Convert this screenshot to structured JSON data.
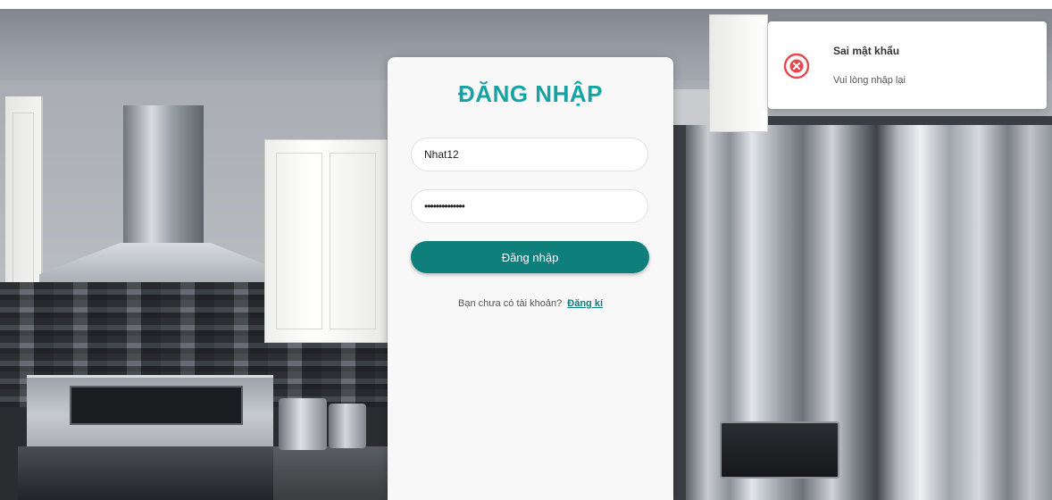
{
  "login": {
    "title": "ĐĂNG NHẬP",
    "username_value": "Nhat12",
    "password_value": "••••••••••••••",
    "submit_label": "Đăng nhập",
    "signup_prompt": "Bạn chưa có tài khoản?",
    "signup_link": "Đăng kí"
  },
  "toast": {
    "title": "Sai mật khẩu",
    "message": "Vui lòng nhập lại",
    "icon": "error-circle-x-icon",
    "color": "#e5484d"
  },
  "colors": {
    "accent": "#17a3a3",
    "button": "#0f7f7c",
    "card": "#f8f8f9"
  }
}
